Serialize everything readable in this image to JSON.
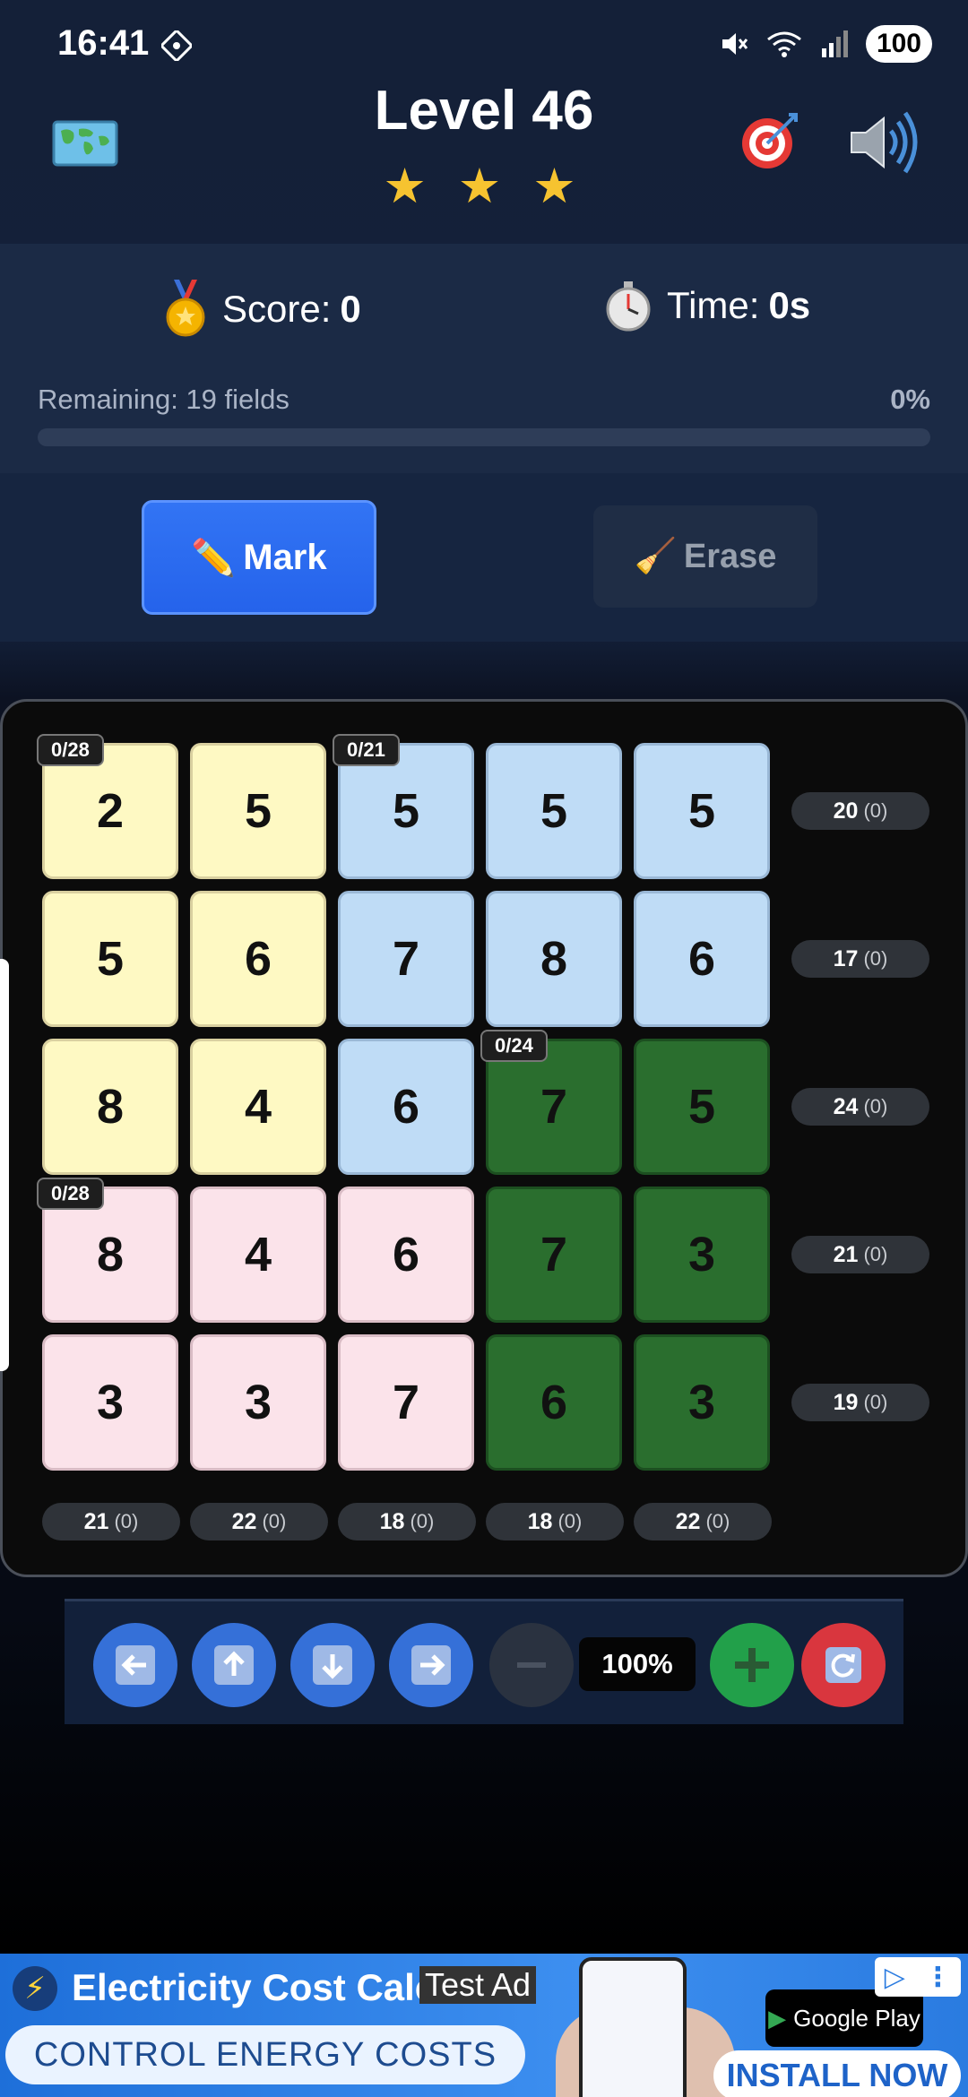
{
  "status_bar": {
    "time": "16:41",
    "battery": "100"
  },
  "header": {
    "title": "Level 46",
    "stars": "★ ★ ★"
  },
  "score": {
    "score_label": "Score:",
    "score_value": "0",
    "time_label": "Time:",
    "time_value": "0s"
  },
  "progress": {
    "remaining_text": "Remaining: 19 fields",
    "percent_text": "0%",
    "fraction": 0
  },
  "modes": {
    "mark_label": "Mark",
    "erase_label": "Erase"
  },
  "grid": {
    "rows": [
      [
        {
          "v": "2",
          "c": "yellow"
        },
        {
          "v": "5",
          "c": "yellow"
        },
        {
          "v": "5",
          "c": "blue"
        },
        {
          "v": "5",
          "c": "blue"
        },
        {
          "v": "5",
          "c": "blue"
        }
      ],
      [
        {
          "v": "5",
          "c": "yellow"
        },
        {
          "v": "6",
          "c": "yellow"
        },
        {
          "v": "7",
          "c": "blue"
        },
        {
          "v": "8",
          "c": "blue"
        },
        {
          "v": "6",
          "c": "blue"
        }
      ],
      [
        {
          "v": "8",
          "c": "yellow"
        },
        {
          "v": "4",
          "c": "yellow"
        },
        {
          "v": "6",
          "c": "blue"
        },
        {
          "v": "7",
          "c": "green"
        },
        {
          "v": "5",
          "c": "green"
        }
      ],
      [
        {
          "v": "8",
          "c": "pink"
        },
        {
          "v": "4",
          "c": "pink"
        },
        {
          "v": "6",
          "c": "pink"
        },
        {
          "v": "7",
          "c": "green"
        },
        {
          "v": "3",
          "c": "green"
        }
      ],
      [
        {
          "v": "3",
          "c": "pink"
        },
        {
          "v": "3",
          "c": "pink"
        },
        {
          "v": "7",
          "c": "pink"
        },
        {
          "v": "6",
          "c": "green"
        },
        {
          "v": "3",
          "c": "green"
        }
      ]
    ],
    "region_tags": [
      {
        "text": "0/28",
        "row": 0,
        "col": 0
      },
      {
        "text": "0/21",
        "row": 0,
        "col": 2
      },
      {
        "text": "0/24",
        "row": 2,
        "col": 3
      },
      {
        "text": "0/28",
        "row": 3,
        "col": 0
      }
    ],
    "row_sums": [
      {
        "target": "20",
        "sub": "(0)"
      },
      {
        "target": "17",
        "sub": "(0)"
      },
      {
        "target": "24",
        "sub": "(0)"
      },
      {
        "target": "21",
        "sub": "(0)"
      },
      {
        "target": "19",
        "sub": "(0)"
      }
    ],
    "col_sums": [
      {
        "target": "21",
        "sub": "(0)"
      },
      {
        "target": "22",
        "sub": "(0)"
      },
      {
        "target": "18",
        "sub": "(0)"
      },
      {
        "target": "18",
        "sub": "(0)"
      },
      {
        "target": "22",
        "sub": "(0)"
      }
    ]
  },
  "controls": {
    "zoom": "100%"
  },
  "ad": {
    "title": "Electricity Cost Calc",
    "test_label": "Test Ad",
    "tagline": "CONTROL ENERGY COSTS",
    "store_label": "Google Play",
    "install_label": "INSTALL NOW"
  },
  "colors": {
    "yellow": "#fef9c3",
    "blue": "#bfdcf6",
    "pink": "#fbe3ea",
    "green": "#2a6e2e",
    "accent": "#2563eb"
  }
}
